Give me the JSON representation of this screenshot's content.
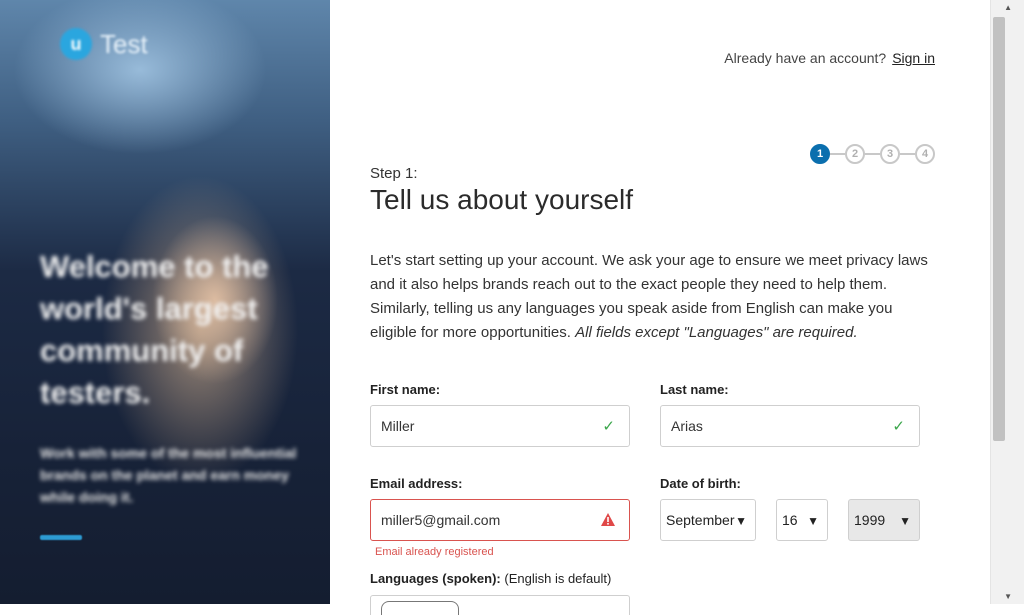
{
  "hero": {
    "logo_mark": "u",
    "logo_text": "Test",
    "headline": "Welcome to the world's largest community of testers.",
    "subtext": "Work with some of the most influential brands on the planet and earn money while doing it."
  },
  "header": {
    "account_prompt": "Already have an account?",
    "signin_label": "Sign in"
  },
  "stepper": {
    "steps": [
      "1",
      "2",
      "3",
      "4"
    ],
    "active": 1
  },
  "form": {
    "step_label": "Step 1:",
    "title": "Tell us about yourself",
    "intro": "Let's start setting up your account. We ask your age to ensure we meet privacy laws and it also helps brands reach out to the exact people they need to help them. Similarly, telling us any languages you speak aside from English can make you eligible for more opportunities.",
    "intro_emphasis": "All fields except \"Languages\" are required.",
    "first_name": {
      "label": "First name:",
      "value": "Miller"
    },
    "last_name": {
      "label": "Last name:",
      "value": "Arias"
    },
    "email": {
      "label": "Email address:",
      "value": "miller5@gmail.com",
      "error": "Email already registered"
    },
    "dob": {
      "label": "Date of birth:",
      "month": "September",
      "day": "16",
      "year": "1999"
    },
    "languages": {
      "label": "Languages (spoken):",
      "hint": "(English is default)"
    }
  },
  "colors": {
    "accent": "#0b6fae",
    "error": "#d9534f",
    "success": "#3aa64a"
  },
  "icons": {
    "valid": "check-icon",
    "invalid": "warning-icon",
    "dropdown": "chevron-down-icon"
  }
}
